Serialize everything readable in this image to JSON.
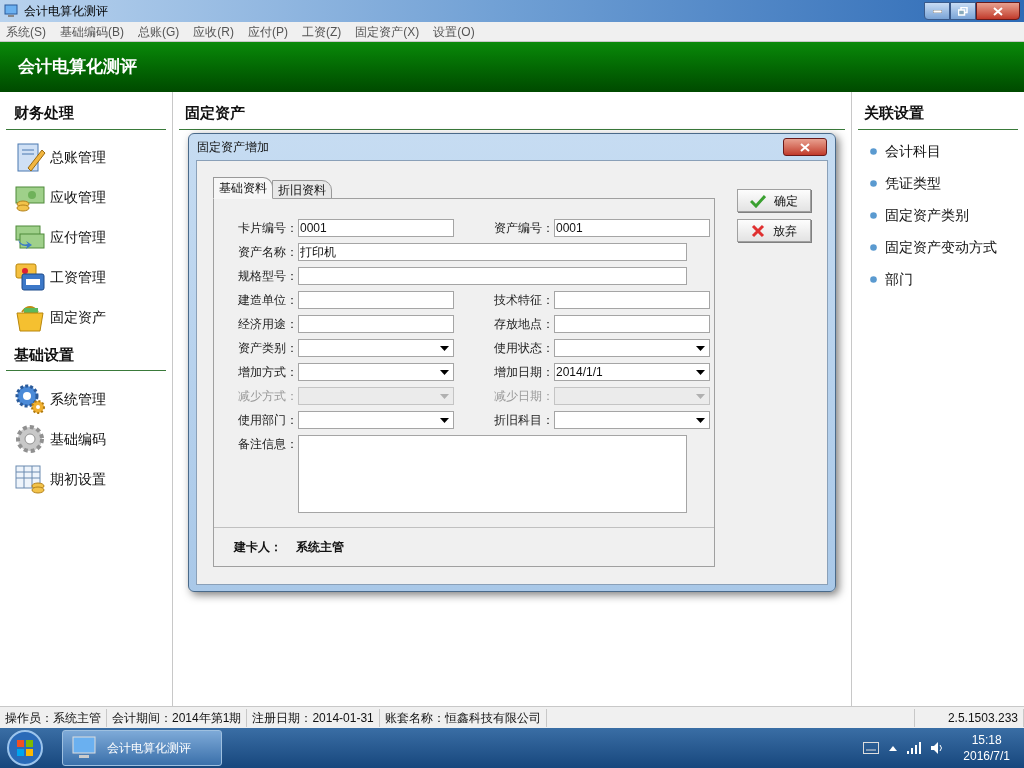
{
  "window": {
    "title": "会计电算化测评"
  },
  "menu": [
    "系统(S)",
    "基础编码(B)",
    "总账(G)",
    "应收(R)",
    "应付(P)",
    "工资(Z)",
    "固定资产(X)",
    "设置(O)"
  ],
  "header": {
    "title": "会计电算化测评"
  },
  "left_sidebar": {
    "sections": [
      {
        "title": "财务处理",
        "items": [
          {
            "label": "总账管理",
            "kind": "ledger"
          },
          {
            "label": "应收管理",
            "kind": "receivable"
          },
          {
            "label": "应付管理",
            "kind": "payable"
          },
          {
            "label": "工资管理",
            "kind": "payroll"
          },
          {
            "label": "固定资产",
            "kind": "assets"
          }
        ]
      },
      {
        "title": "基础设置",
        "items": [
          {
            "label": "系统管理",
            "kind": "system"
          },
          {
            "label": "基础编码",
            "kind": "coding"
          },
          {
            "label": "期初设置",
            "kind": "opening"
          }
        ]
      }
    ]
  },
  "center": {
    "title": "固定资产"
  },
  "right_sidebar": {
    "title": "关联设置",
    "items": [
      "会计科目",
      "凭证类型",
      "固定资产类别",
      "固定资产变动方式",
      "部门"
    ]
  },
  "dialog": {
    "title": "固定资产增加",
    "tabs": [
      {
        "label": "基础资料",
        "selected": true
      },
      {
        "label": "折旧资料",
        "selected": false
      }
    ],
    "rows": [
      [
        {
          "label": "卡片编号：",
          "kind": "text",
          "value": "0001",
          "disabled": false
        },
        {
          "label": "资产编号：",
          "kind": "text",
          "value": "0001",
          "disabled": false
        }
      ],
      [
        {
          "label": "资产名称：",
          "kind": "wide",
          "value": "打印机",
          "disabled": false
        }
      ],
      [
        {
          "label": "规格型号：",
          "kind": "wide",
          "disabled": false
        }
      ],
      [
        {
          "label": "建造单位：",
          "kind": "text",
          "disabled": false
        },
        {
          "label": "技术特征：",
          "kind": "text",
          "disabled": false
        }
      ],
      [
        {
          "label": "经济用途：",
          "kind": "text",
          "disabled": false
        },
        {
          "label": "存放地点：",
          "kind": "text",
          "disabled": false
        }
      ],
      [
        {
          "label": "资产类别：",
          "kind": "select",
          "disabled": false
        },
        {
          "label": "使用状态：",
          "kind": "select",
          "disabled": false
        }
      ],
      [
        {
          "label": "增加方式：",
          "kind": "select",
          "disabled": false
        },
        {
          "label": "增加日期：",
          "kind": "select",
          "value": "2014/1/1",
          "disabled": false
        }
      ],
      [
        {
          "label": "减少方式：",
          "kind": "select",
          "disabled": true
        },
        {
          "label": "减少日期：",
          "kind": "select",
          "disabled": true
        }
      ],
      [
        {
          "label": "使用部门：",
          "kind": "select",
          "disabled": false
        },
        {
          "label": "折旧科目：",
          "kind": "select",
          "disabled": false
        }
      ],
      [
        {
          "label": "备注信息：",
          "kind": "textarea",
          "disabled": false
        }
      ]
    ],
    "creator": {
      "label": "建卡人：",
      "value": "系统主管"
    },
    "buttons": [
      {
        "label": "确定",
        "kind": "ok"
      },
      {
        "label": "放弃",
        "kind": "cancel"
      }
    ]
  },
  "status_bar": [
    "操作员：系统主管",
    "会计期间：2014年第1期",
    "注册日期：2014-01-31",
    "账套名称：恒鑫科技有限公司",
    "2.5.1503.233"
  ],
  "taskbar": {
    "app": "会计电算化测评",
    "time": "15:18",
    "date": "2016/7/1"
  }
}
